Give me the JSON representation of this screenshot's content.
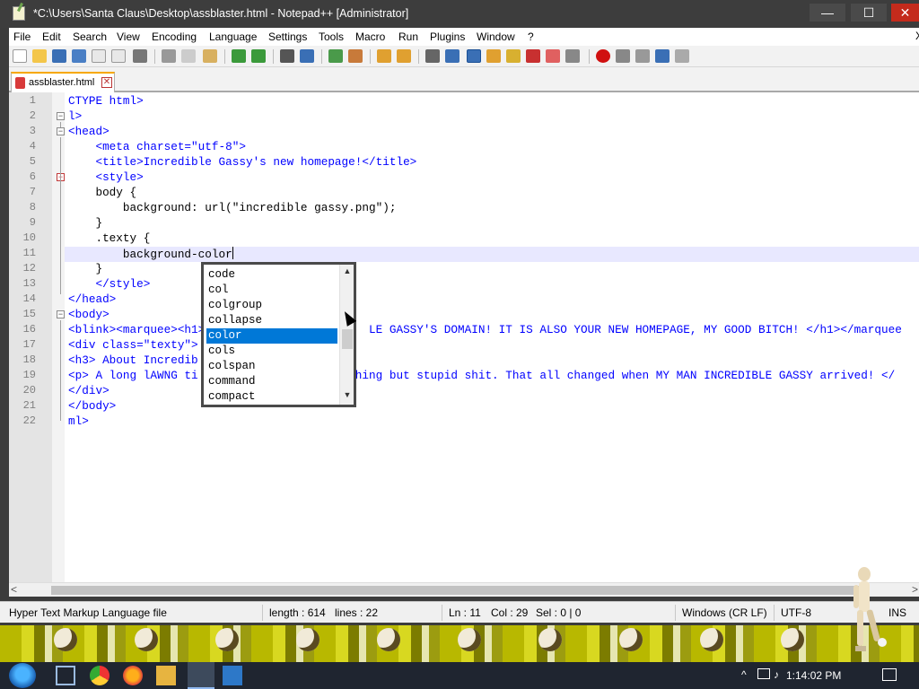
{
  "window": {
    "title": "*C:\\Users\\Santa Claus\\Desktop\\assblaster.html - Notepad++ [Administrator]",
    "min_glyph": "—",
    "max_glyph": "☐",
    "close_glyph": "✕"
  },
  "menu": [
    "File",
    "Edit",
    "Search",
    "View",
    "Encoding",
    "Language",
    "Settings",
    "Tools",
    "Macro",
    "Run",
    "Plugins",
    "Window",
    "?"
  ],
  "menu_close": "X",
  "tab": {
    "label": "assblaster.html",
    "close": "✕"
  },
  "editor": {
    "line_numbers": [
      "1",
      "2",
      "3",
      "4",
      "5",
      "6",
      "7",
      "8",
      "9",
      "10",
      "11",
      "12",
      "13",
      "14",
      "15",
      "16",
      "17",
      "18",
      "19",
      "20",
      "21",
      "22"
    ],
    "lines": [
      "CTYPE html>",
      "l>",
      "<head>",
      "    <meta charset=\"utf-8\">",
      "    <title>Incredible Gassy's new homepage!</title>",
      "    <style>",
      "    body {",
      "        background: url(\"incredible gassy.png\");",
      "    }",
      "    .texty {",
      "        background-color",
      "    }",
      "    </style>",
      "</head>",
      "<body>",
      "<blink><marquee><h1>                        LE GASSY'S DOMAIN! IT IS ALSO YOUR NEW HOMEPAGE, MY GOOD BITCH! </h1></marquee",
      "<div class=\"texty\">",
      "<h3> About Incredib",
      "<p> A long lAWNG ti                      thing but stupid shit. That all changed when MY MAN INCREDIBLE GASSY arrived! </",
      "</div>",
      "</body>",
      "ml>"
    ]
  },
  "autocomplete": {
    "options": [
      "code",
      "col",
      "colgroup",
      "collapse",
      "color",
      "cols",
      "colspan",
      "command",
      "compact"
    ],
    "selected": "color",
    "up": "▲",
    "down": "▼"
  },
  "hscroll": {
    "left": "<",
    "right": ">"
  },
  "status": {
    "filetype": "Hyper Text Markup Language file",
    "length": "length : 614",
    "lines": "lines : 22",
    "ln": "Ln : 11",
    "col": "Col : 29",
    "sel": "Sel : 0 | 0",
    "eol": "Windows (CR LF)",
    "encoding": "UTF-8",
    "mode": "INS"
  },
  "taskbar": {
    "clock": "1:14:02 PM",
    "tray_arrow": "^"
  },
  "colors": {
    "accent_tab": "#f6a800",
    "selection": "#0078d7",
    "tag": "#0000ff",
    "attr": "#ff0000",
    "string": "#8000ff"
  }
}
